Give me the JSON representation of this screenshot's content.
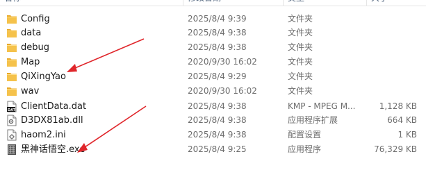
{
  "header": {
    "name": "名称",
    "date_modified": "修改日期",
    "type": "类型",
    "size": "大小"
  },
  "files": [
    {
      "name": "Config",
      "date": "2025/8/4 9:39",
      "type": "文件夹",
      "size": "",
      "icon": "folder-icon"
    },
    {
      "name": "data",
      "date": "2025/8/4 9:38",
      "type": "文件夹",
      "size": "",
      "icon": "folder-icon"
    },
    {
      "name": "debug",
      "date": "2025/8/4 9:38",
      "type": "文件夹",
      "size": "",
      "icon": "folder-icon"
    },
    {
      "name": "Map",
      "date": "2020/9/30 16:02",
      "type": "文件夹",
      "size": "",
      "icon": "folder-icon"
    },
    {
      "name": "QiXingYao",
      "date": "2025/8/4 9:29",
      "type": "文件夹",
      "size": "",
      "icon": "folder-icon"
    },
    {
      "name": "wav",
      "date": "2020/9/30 16:02",
      "type": "文件夹",
      "size": "",
      "icon": "folder-icon"
    },
    {
      "name": "ClientData.dat",
      "date": "2025/8/4 9:38",
      "type": "KMP - MPEG M...",
      "size": "1,128 KB",
      "icon": "dat-file-icon"
    },
    {
      "name": "D3DX81ab.dll",
      "date": "2025/8/4 9:38",
      "type": "应用程序扩展",
      "size": "664 KB",
      "icon": "dll-file-icon"
    },
    {
      "name": "haom2.ini",
      "date": "2025/8/4 9:38",
      "type": "配置设置",
      "size": "1 KB",
      "icon": "ini-file-icon"
    },
    {
      "name": "黑神话悟空.exe",
      "date": "2025/8/4 9:25",
      "type": "应用程序",
      "size": "76,329 KB",
      "icon": "exe-file-icon"
    }
  ],
  "colors": {
    "annotation_arrow": "#e0262b",
    "folder": "#f5c24b",
    "header_text": "#4c607a",
    "secondary_text": "#6d6d6d"
  }
}
